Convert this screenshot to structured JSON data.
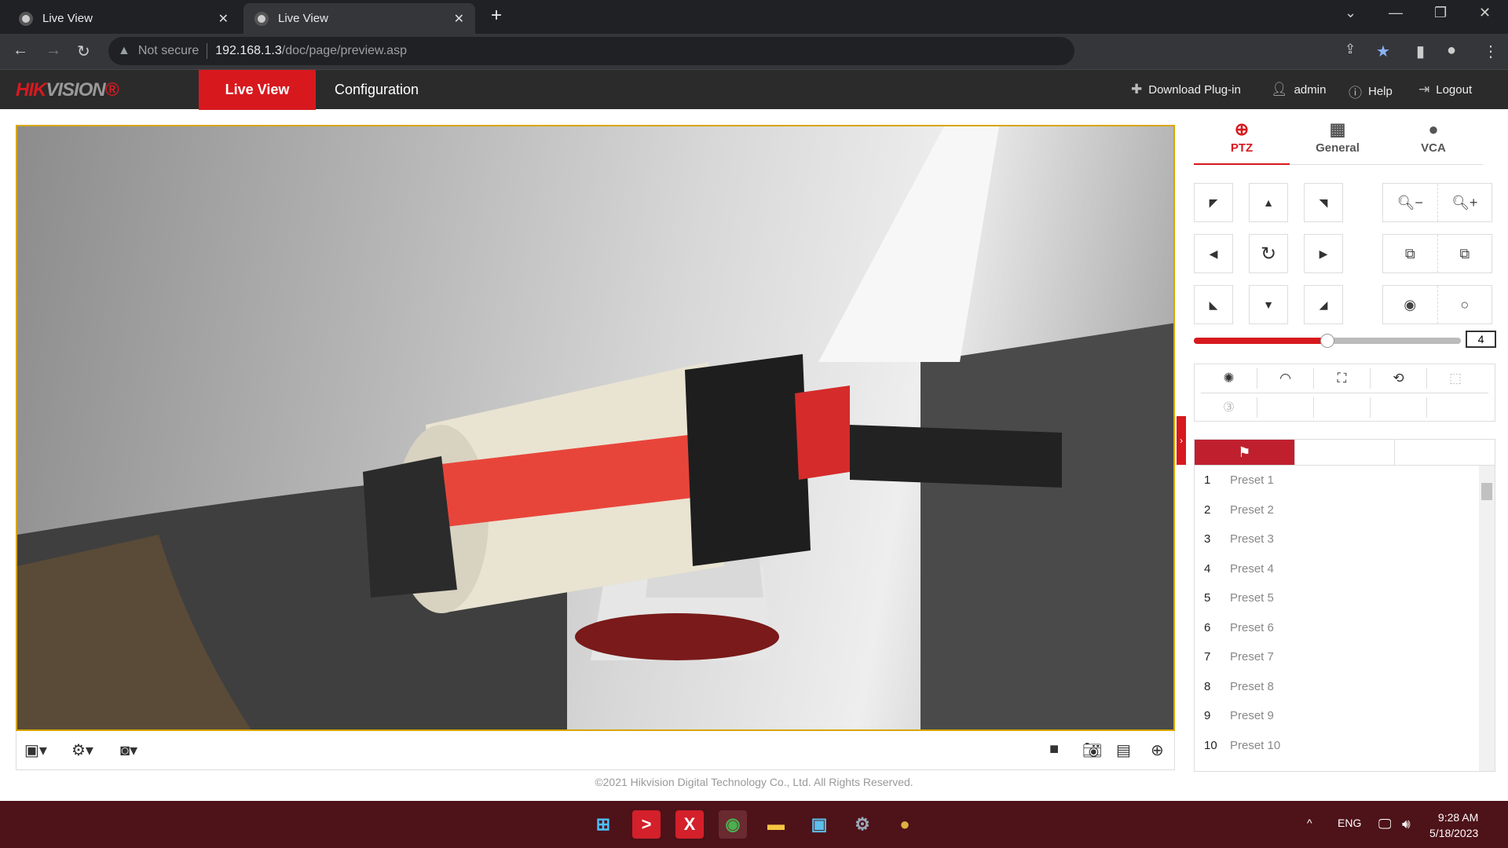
{
  "browser": {
    "tabs": [
      {
        "title": "Live View",
        "active": false
      },
      {
        "title": "Live View",
        "active": true
      }
    ],
    "address": {
      "security": "Not secure",
      "host": "192.168.1.3",
      "path": "/doc/page/preview.asp"
    }
  },
  "header": {
    "logo": "HIKVISION",
    "nav": [
      {
        "label": "Live View",
        "active": true
      },
      {
        "label": "Configuration",
        "active": false
      }
    ],
    "links": {
      "plugin": "Download Plug-in",
      "user": "admin",
      "help": "Help",
      "logout": "Logout"
    },
    "accent": "#d7191e"
  },
  "panel": {
    "tabs": [
      {
        "label": "PTZ",
        "icon": "ptz-icon",
        "active": true
      },
      {
        "label": "General",
        "icon": "grid-icon"
      },
      {
        "label": "VCA",
        "icon": "bulb-icon"
      }
    ],
    "speed": {
      "value": "4",
      "fraction": 0.5
    },
    "presets": [
      {
        "n": "1",
        "label": "Preset 1"
      },
      {
        "n": "2",
        "label": "Preset 2"
      },
      {
        "n": "3",
        "label": "Preset 3"
      },
      {
        "n": "4",
        "label": "Preset 4"
      },
      {
        "n": "5",
        "label": "Preset 5"
      },
      {
        "n": "6",
        "label": "Preset 6"
      },
      {
        "n": "7",
        "label": "Preset 7"
      },
      {
        "n": "8",
        "label": "Preset 8"
      },
      {
        "n": "9",
        "label": "Preset 9"
      },
      {
        "n": "10",
        "label": "Preset 10"
      }
    ]
  },
  "footer": "©2021 Hikvision Digital Technology Co., Ltd. All Rights Reserved.",
  "taskbar": {
    "lang": "ENG",
    "time": "9:28 AM",
    "date": "5/18/2023"
  }
}
